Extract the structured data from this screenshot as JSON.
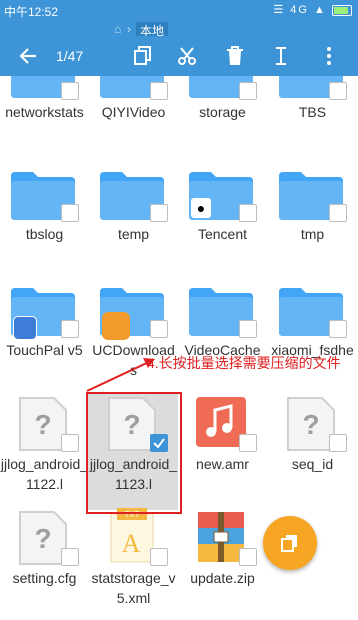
{
  "status": {
    "time": "中午12:52",
    "signal_text": "4G"
  },
  "breadcrumb": {
    "home_icon": "home-icon",
    "current": "本地"
  },
  "toolbar": {
    "counter": "1/47"
  },
  "files": [
    {
      "name": "networkstats",
      "type": "folder",
      "checked": false
    },
    {
      "name": "QIYIVideo",
      "type": "folder",
      "checked": false
    },
    {
      "name": "storage",
      "type": "folder",
      "checked": false
    },
    {
      "name": "TBS",
      "type": "folder",
      "checked": false
    },
    {
      "name": "tbslog",
      "type": "folder",
      "checked": false
    },
    {
      "name": "temp",
      "type": "folder",
      "checked": false
    },
    {
      "name": "Tencent",
      "type": "folder",
      "badge": "qq-icon",
      "checked": false
    },
    {
      "name": "tmp",
      "type": "folder",
      "checked": false
    },
    {
      "name": "TouchPal v5",
      "type": "folder",
      "badge": "touchpal-icon",
      "checked": false
    },
    {
      "name": "UCDownloads",
      "type": "folder",
      "badge": "uc-icon",
      "checked": false
    },
    {
      "name": "VideoCache",
      "type": "folder",
      "checked": false
    },
    {
      "name": "xiaomi_fsdhe",
      "type": "folder",
      "checked": false
    },
    {
      "name": "jjlog_android_1122.l",
      "type": "unknown",
      "checked": false
    },
    {
      "name": "jjlog_android_1123.l",
      "type": "unknown",
      "checked": true
    },
    {
      "name": "new.amr",
      "type": "audio",
      "checked": false
    },
    {
      "name": "seq_id",
      "type": "unknown",
      "checked": false
    },
    {
      "name": "setting.cfg",
      "type": "unknown",
      "checked": false
    },
    {
      "name": "statstorage_v5.xml",
      "type": "txt",
      "checked": false
    },
    {
      "name": "update.zip",
      "type": "zip",
      "checked": false
    }
  ],
  "annotation": "4.长按批量选择需要压缩的文件",
  "colors": {
    "accent": "#3d94d6",
    "annotation": "#e02020",
    "fab": "#f6a623",
    "folder": "#64b5f6",
    "folder_dark": "#42a5f5"
  }
}
